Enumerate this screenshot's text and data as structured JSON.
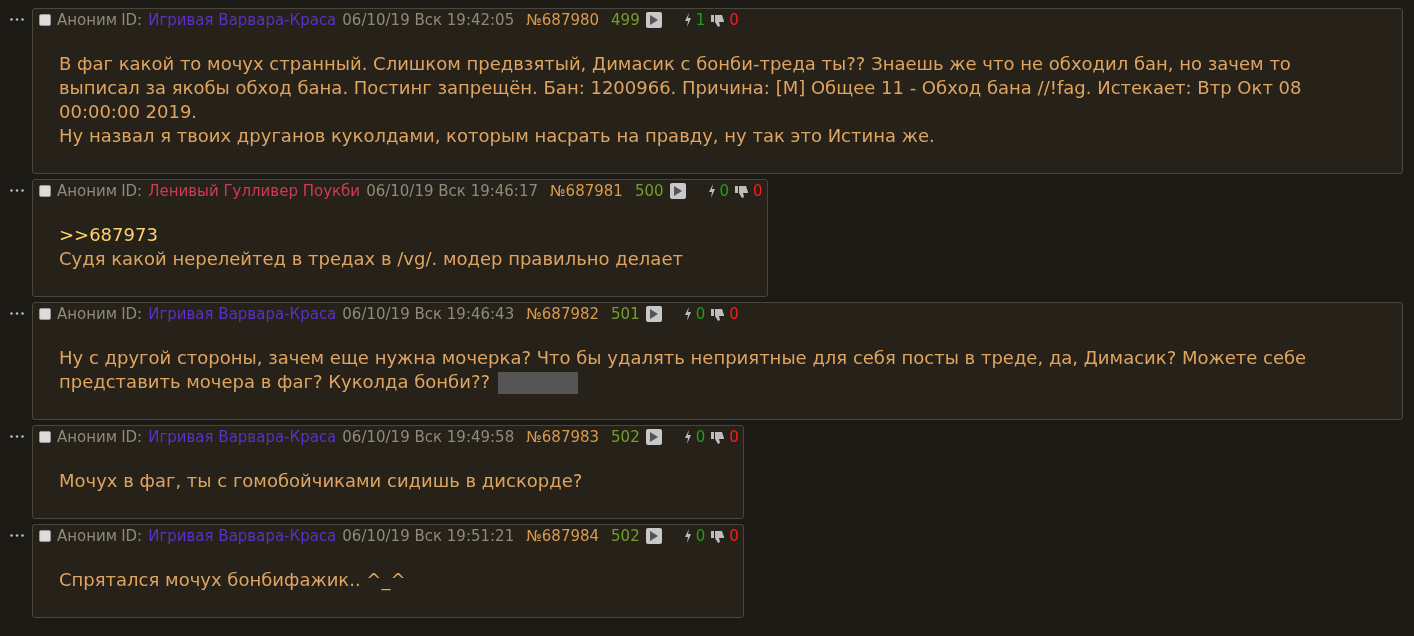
{
  "posts": [
    {
      "author": "Аноним",
      "id_label": "ID:",
      "name": "Игривая Варвара-Краса",
      "color": "#5c30c8",
      "date": "06/10/19 Вск 19:42:05",
      "number": "№687980",
      "count": "499",
      "likes": "1",
      "dislikes": "0",
      "checked": false,
      "spoiler": false,
      "full": true,
      "lines": [
        {
          "kind": "text",
          "text": "В фаг какой то мочух странный. Слишком предвзятый, Димасик с бонби-треда ты?? Знаешь же что не обходил бан, но зачем то выписал за якобы обход бана. Постинг запрещён. Бан: 1200966. Причина: [M] Общее 11 - Обход бана //!fag. Истекает: Втр Окт 08 00:00:00 2019."
        },
        {
          "kind": "text",
          "text": "Ну назвал я твоих друганов куколдами, которым насрать на правду, ну так это Истина же."
        }
      ]
    },
    {
      "author": "Аноним",
      "id_label": "ID:",
      "name": "Ленивый Гулливер Поукби",
      "color": "#d03a5a",
      "date": "06/10/19 Вск 19:46:17",
      "number": "№687981",
      "count": "500",
      "likes": "0",
      "dislikes": "0",
      "checked": false,
      "spoiler": false,
      "full": false,
      "lines": [
        {
          "kind": "reply_link",
          "text": ">>687973"
        },
        {
          "kind": "text",
          "text": "Судя какой нерелейтед в тредах в /vg/. модер правильно делает"
        }
      ]
    },
    {
      "author": "Аноним",
      "id_label": "ID:",
      "name": "Игривая Варвара-Краса",
      "color": "#5c30c8",
      "date": "06/10/19 Вск 19:46:43",
      "number": "№687982",
      "count": "501",
      "likes": "0",
      "dislikes": "0",
      "checked": false,
      "spoiler": true,
      "full": true,
      "lines": [
        {
          "kind": "text",
          "text": "Ну с другой стороны, зачем еще нужна мочерка? Что бы удалять неприятные для себя посты в треде, да, Димасик? Можете себе представить мочера в фаг? Куколда бонби??"
        }
      ]
    },
    {
      "author": "Аноним",
      "id_label": "ID:",
      "name": "Игривая Варвара-Краса",
      "color": "#5c30c8",
      "date": "06/10/19 Вск 19:49:58",
      "number": "№687983",
      "count": "502",
      "likes": "0",
      "dislikes": "0",
      "checked": false,
      "spoiler": false,
      "full": false,
      "lines": [
        {
          "kind": "text",
          "text": "Мочух в фаг, ты с гомобойчиками сидишь в дискорде?"
        }
      ]
    },
    {
      "author": "Аноним",
      "id_label": "ID:",
      "name": "Игривая Варвара-Краса",
      "color": "#5c30c8",
      "date": "06/10/19 Вск 19:51:21",
      "number": "№687984",
      "count": "502",
      "likes": "0",
      "dislikes": "0",
      "checked": false,
      "spoiler": false,
      "full": false,
      "lines": [
        {
          "kind": "text",
          "text": "Спрятался мочух бонбифажик.. ^_^"
        }
      ]
    }
  ]
}
